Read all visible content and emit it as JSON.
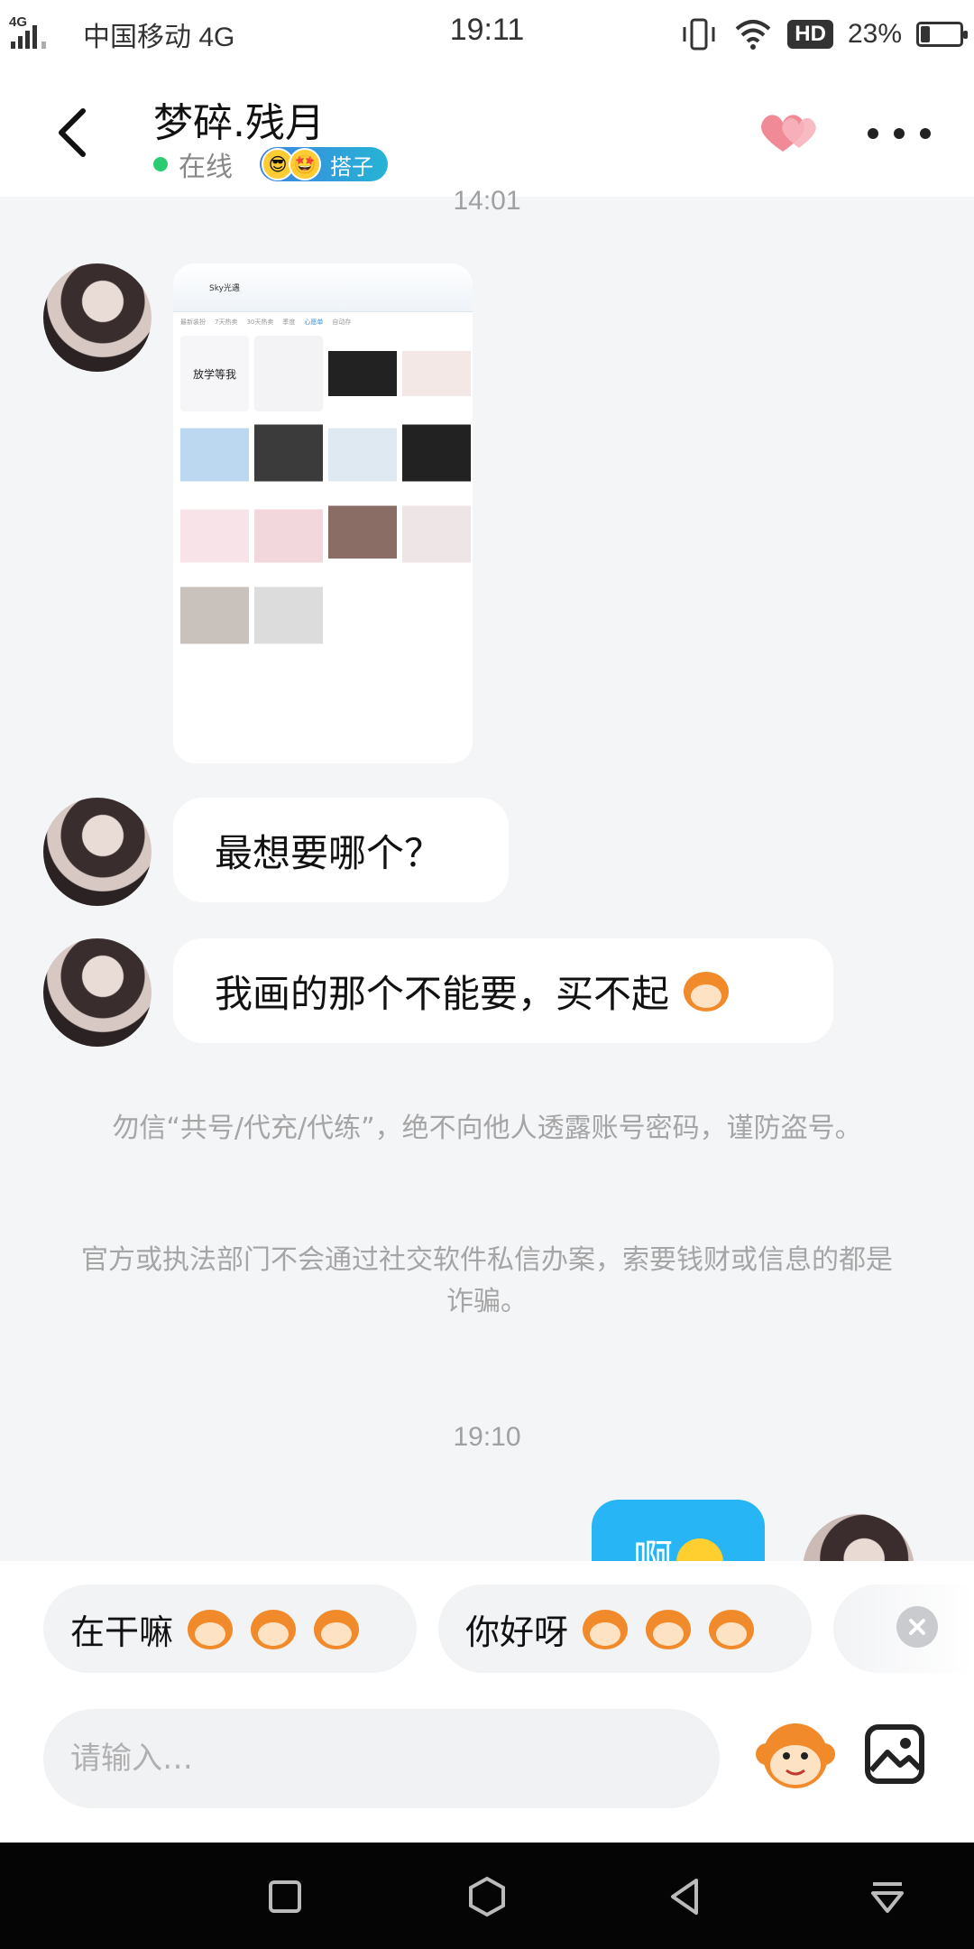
{
  "status_bar": {
    "signal_label": "4G",
    "carrier": "中国移动 4G",
    "time": "19:11",
    "hd_label": "HD",
    "battery_percent_text": "23%",
    "battery_level": 0.23
  },
  "header": {
    "contact_name": "梦碎.残月",
    "status": "在线",
    "tag_label": "搭子"
  },
  "chat": {
    "timestamp_1": "14:01",
    "image_message": {
      "app_title": "Sky光遇",
      "tabs": [
        "最新装扮",
        "7天热卖",
        "30天热卖",
        "季度",
        "心愿单",
        "自动存"
      ],
      "first_cell_text": "放学等我"
    },
    "messages": [
      {
        "from": "contact",
        "text": "最想要哪个？"
      },
      {
        "from": "contact",
        "text": "我画的那个不能要，买不起"
      }
    ],
    "notice_1": "勿信“共号/代充/代练”，绝不向他人透露账号密码，谨防盗号。",
    "notice_2": "官方或执法部门不会通过社交软件私信办案，索要钱财或信息的都是诈骗。",
    "timestamp_2": "19:10",
    "sent_message": "啊"
  },
  "quick_replies": [
    {
      "text": "在干嘛"
    },
    {
      "text": "你好呀"
    }
  ],
  "input": {
    "placeholder": "请输入…"
  },
  "colors": {
    "accent": "#27b5f5",
    "online": "#2ecc71",
    "hearts": "#f26b7a"
  },
  "icons": {
    "back": "chevron-left-icon",
    "more": "more-dots-icon",
    "hearts": "hearts-icon",
    "emoji": "monkey-emoji-icon",
    "image": "image-icon",
    "close": "close-icon"
  }
}
